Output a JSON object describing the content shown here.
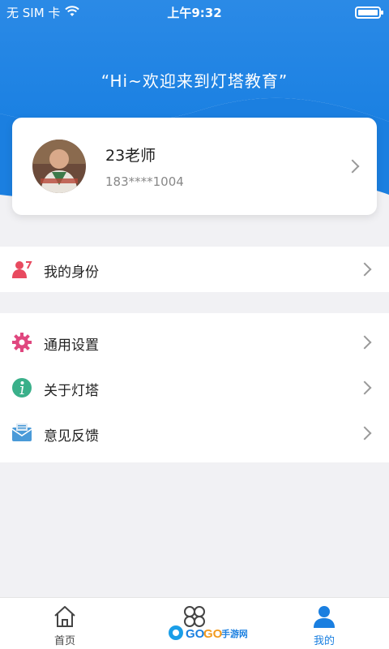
{
  "status_bar": {
    "carrier": "无 SIM 卡",
    "time": "上午9:32",
    "wifi_icon": "wifi-icon",
    "battery_icon": "battery-icon"
  },
  "header": {
    "welcome": "“Hi~欢迎来到灯塔教育”",
    "colors": {
      "gradient_top": "#2f8be6",
      "gradient_bottom": "#1a7fe0"
    }
  },
  "profile": {
    "name": "23老师",
    "phone": "183****1004",
    "avatar_icon": "avatar-photo"
  },
  "menu_primary": [
    {
      "label": "我的身份",
      "icon": "identity-icon"
    }
  ],
  "menu_secondary": [
    {
      "label": "通用设置",
      "icon": "gear-icon"
    },
    {
      "label": "关于灯塔",
      "icon": "info-icon"
    },
    {
      "label": "意见反馈",
      "icon": "feedback-icon"
    }
  ],
  "tabbar": {
    "tabs": [
      {
        "label": "首页",
        "icon": "home-icon"
      },
      {
        "label": "",
        "icon": "apps-icon"
      },
      {
        "label": "我的",
        "icon": "user-icon"
      }
    ],
    "active_color": "#1a7fe0"
  },
  "watermark": {
    "text": "GOGO手游网"
  }
}
